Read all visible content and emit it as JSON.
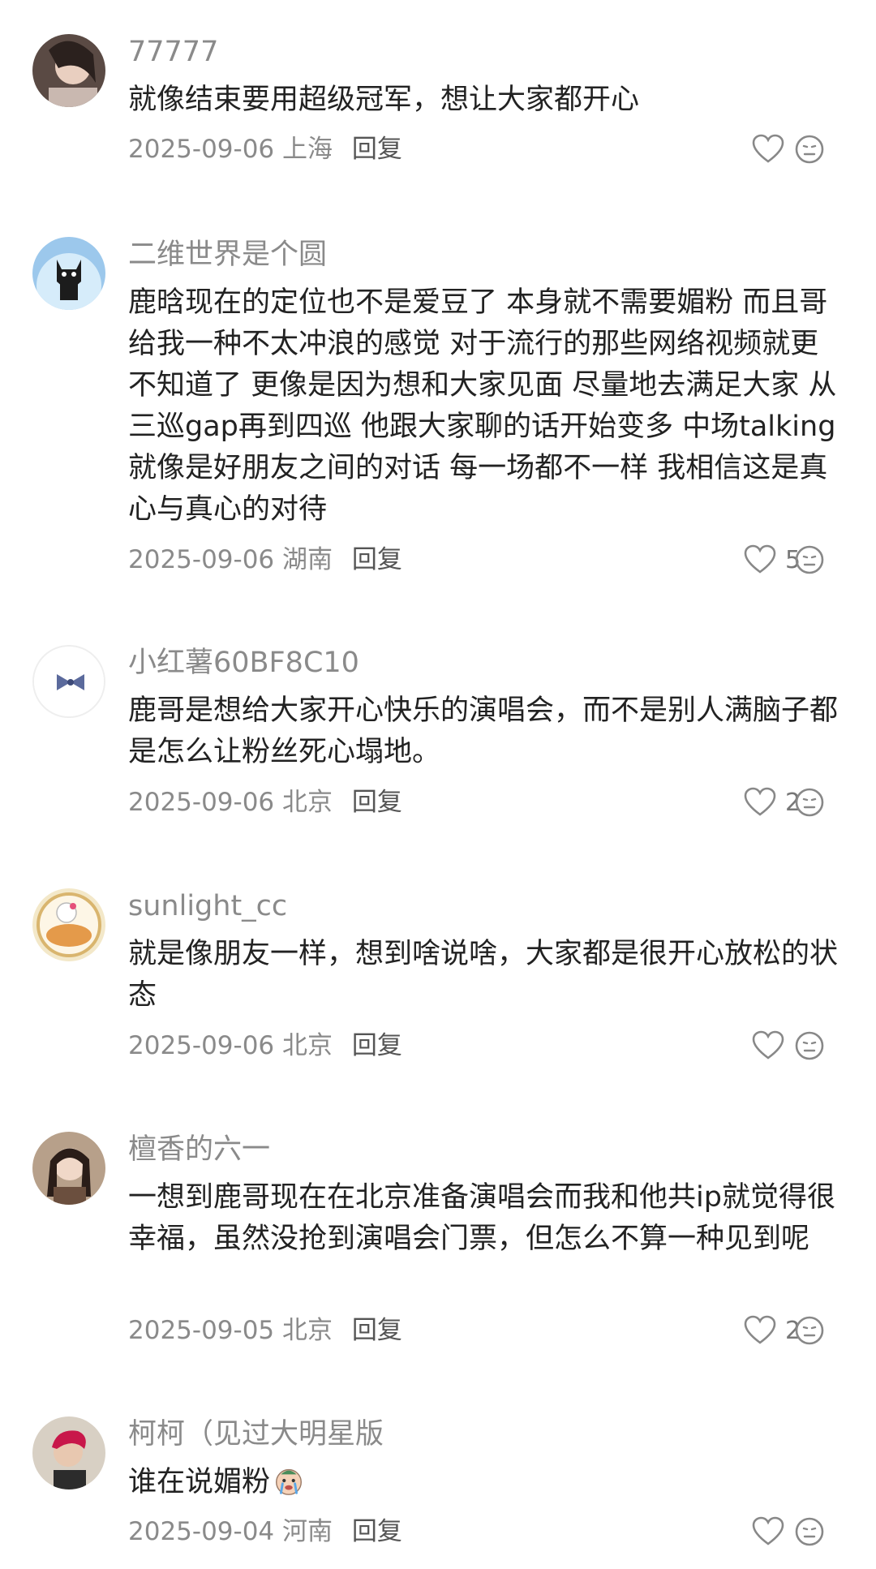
{
  "comments": [
    {
      "username": "77777",
      "text": "就像结束要用超级冠军，想让大家都开心",
      "date": "2025-09-06",
      "location": "上海",
      "reply_label": "回复",
      "likes": ""
    },
    {
      "username": "二维世界是个圆",
      "text": "鹿晗现在的定位也不是爱豆了 本身就不需要媚粉 而且哥给我一种不太冲浪的感觉 对于流行的那些网络视频就更不知道了 更像是因为想和大家见面 尽量地去满足大家 从三巡gap再到四巡 他跟大家聊的话开始变多 中场talking就像是好朋友之间的对话 每一场都不一样 我相信这是真心与真心的对待",
      "date": "2025-09-06",
      "location": "湖南",
      "reply_label": "回复",
      "likes": "5"
    },
    {
      "username": "小红薯60BF8C10",
      "text": "鹿哥是想给大家开心快乐的演唱会，而不是别人满脑子都是怎么让粉丝死心塌地。",
      "date": "2025-09-06",
      "location": "北京",
      "reply_label": "回复",
      "likes": "2"
    },
    {
      "username": "sunlight_cc",
      "text": "就是像朋友一样，想到啥说啥，大家都是很开心放松的状态",
      "date": "2025-09-06",
      "location": "北京",
      "reply_label": "回复",
      "likes": ""
    },
    {
      "username": "檀香的六一",
      "text": "一想到鹿哥现在在北京准备演唱会而我和他共ip就觉得很幸福，虽然没抢到演唱会门票，但怎么不算一种见到呢",
      "date": "2025-09-05",
      "location": "北京",
      "reply_label": "回复",
      "likes": "2"
    },
    {
      "username": "柯柯（见过大明星版",
      "text": "谁在说媚粉",
      "date": "2025-09-04",
      "location": "河南",
      "reply_label": "回复",
      "likes": ""
    }
  ],
  "icons": {
    "like": "heart-outline-icon",
    "dislike": "unhappy-face-icon",
    "emoji": "crying-sticker-emoji"
  },
  "colors": {
    "meta_text": "#8a8a8a",
    "body_text": "#222222",
    "icon_stroke": "#888888"
  }
}
